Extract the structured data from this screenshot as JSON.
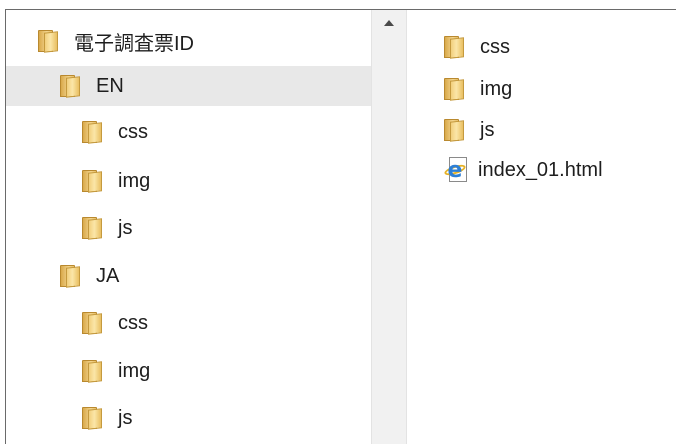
{
  "tree": {
    "root": {
      "label": "電子調査票ID"
    },
    "en": {
      "label": "EN"
    },
    "en_css": {
      "label": "css"
    },
    "en_img": {
      "label": "img"
    },
    "en_js": {
      "label": "js"
    },
    "ja": {
      "label": "JA"
    },
    "ja_css": {
      "label": "css"
    },
    "ja_img": {
      "label": "img"
    },
    "ja_js": {
      "label": "js"
    }
  },
  "content": {
    "items": [
      {
        "label": "css",
        "icon": "folder-icon"
      },
      {
        "label": "img",
        "icon": "folder-icon"
      },
      {
        "label": "js",
        "icon": "folder-icon"
      },
      {
        "label": "index_01.html",
        "icon": "ie-html-file-icon"
      }
    ]
  },
  "colors": {
    "folder": "#f1cf7d",
    "selection": "#e8e8e8",
    "ie_blue": "#2d7fd6"
  }
}
